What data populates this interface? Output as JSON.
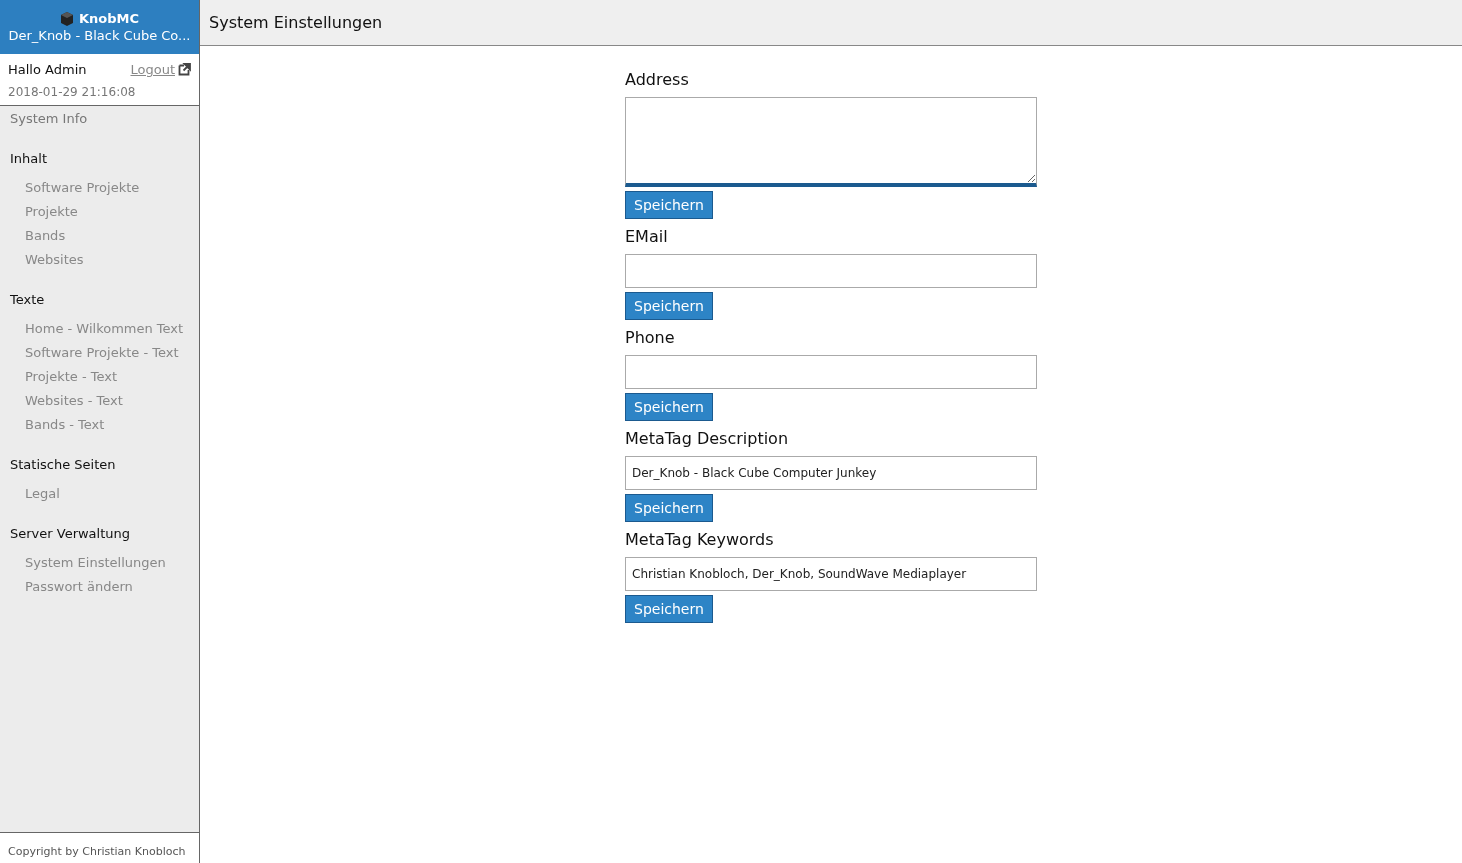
{
  "brand": {
    "title": "KnobMC",
    "subtitle": "Der_Knob - Black Cube Co..."
  },
  "user": {
    "greeting": "Hallo Admin",
    "logout": "Logout",
    "timestamp": "2018-01-29 21:16:08"
  },
  "sidebar": {
    "top_item": {
      "label": "System Info",
      "selected": false
    },
    "sections": [
      {
        "title": "Inhalt",
        "items": [
          {
            "label": "Software Projekte",
            "selected": false
          },
          {
            "label": "Projekte",
            "selected": false
          },
          {
            "label": "Bands",
            "selected": false
          },
          {
            "label": "Websites",
            "selected": false
          }
        ]
      },
      {
        "title": "Texte",
        "items": [
          {
            "label": "Home - Wilkommen Text",
            "selected": false
          },
          {
            "label": "Software Projekte - Text",
            "selected": false
          },
          {
            "label": "Projekte - Text",
            "selected": false
          },
          {
            "label": "Websites - Text",
            "selected": false
          },
          {
            "label": "Bands - Text",
            "selected": false
          }
        ]
      },
      {
        "title": "Statische Seiten",
        "items": [
          {
            "label": "Legal",
            "selected": false
          }
        ]
      },
      {
        "title": "Server Verwaltung",
        "items": [
          {
            "label": "System Einstellungen",
            "selected": false
          },
          {
            "label": "Passwort ändern",
            "selected": false
          }
        ]
      }
    ]
  },
  "footer": "Copyright by Christian Knobloch",
  "page_title": "System Einstellungen",
  "fields": [
    {
      "label": "Address",
      "kind": "textarea",
      "focused": true,
      "button": "Speichern"
    },
    {
      "label": "EMail",
      "kind": "input",
      "focused": false,
      "button": "Speichern"
    },
    {
      "label": "Phone",
      "kind": "input",
      "focused": false,
      "button": "Speichern"
    },
    {
      "label": "MetaTag Description",
      "kind": "input",
      "value": "Der_Knob - Black Cube Computer Junkey",
      "focused": false,
      "button": "Speichern"
    },
    {
      "label": "MetaTag Keywords",
      "kind": "input",
      "value": "Christian Knobloch, Der_Knob, SoundWave Mediaplayer",
      "focused": false,
      "button": "Speichern"
    }
  ]
}
